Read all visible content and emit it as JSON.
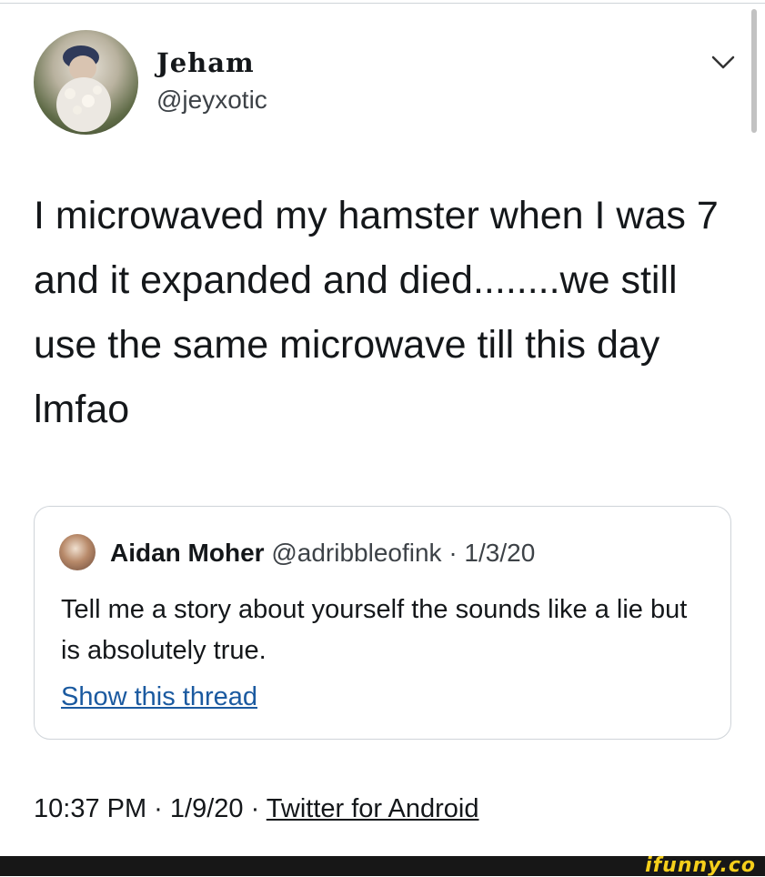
{
  "tweet": {
    "display_name": "Jeham",
    "handle": "@jeyxotic",
    "text": "I microwaved my hamster when I was 7 and it expanded and died........we still use the same microwave till this day lmfao",
    "timestamp": "10:37 PM · 1/9/20 · ",
    "source": "Twitter for Android",
    "menu_icon": "chevron-down-icon"
  },
  "quoted_tweet": {
    "display_name": "Aidan Moher",
    "meta": " @adribbleofink · 1/3/20",
    "text": "Tell me a story about yourself the sounds like a lie but is absolutely true.",
    "link": "Show this thread"
  },
  "watermark": "ifunny.co",
  "colors": {
    "link": "#1b5aa0",
    "border": "#cfd4d9",
    "watermark": "#f5cf1b"
  }
}
